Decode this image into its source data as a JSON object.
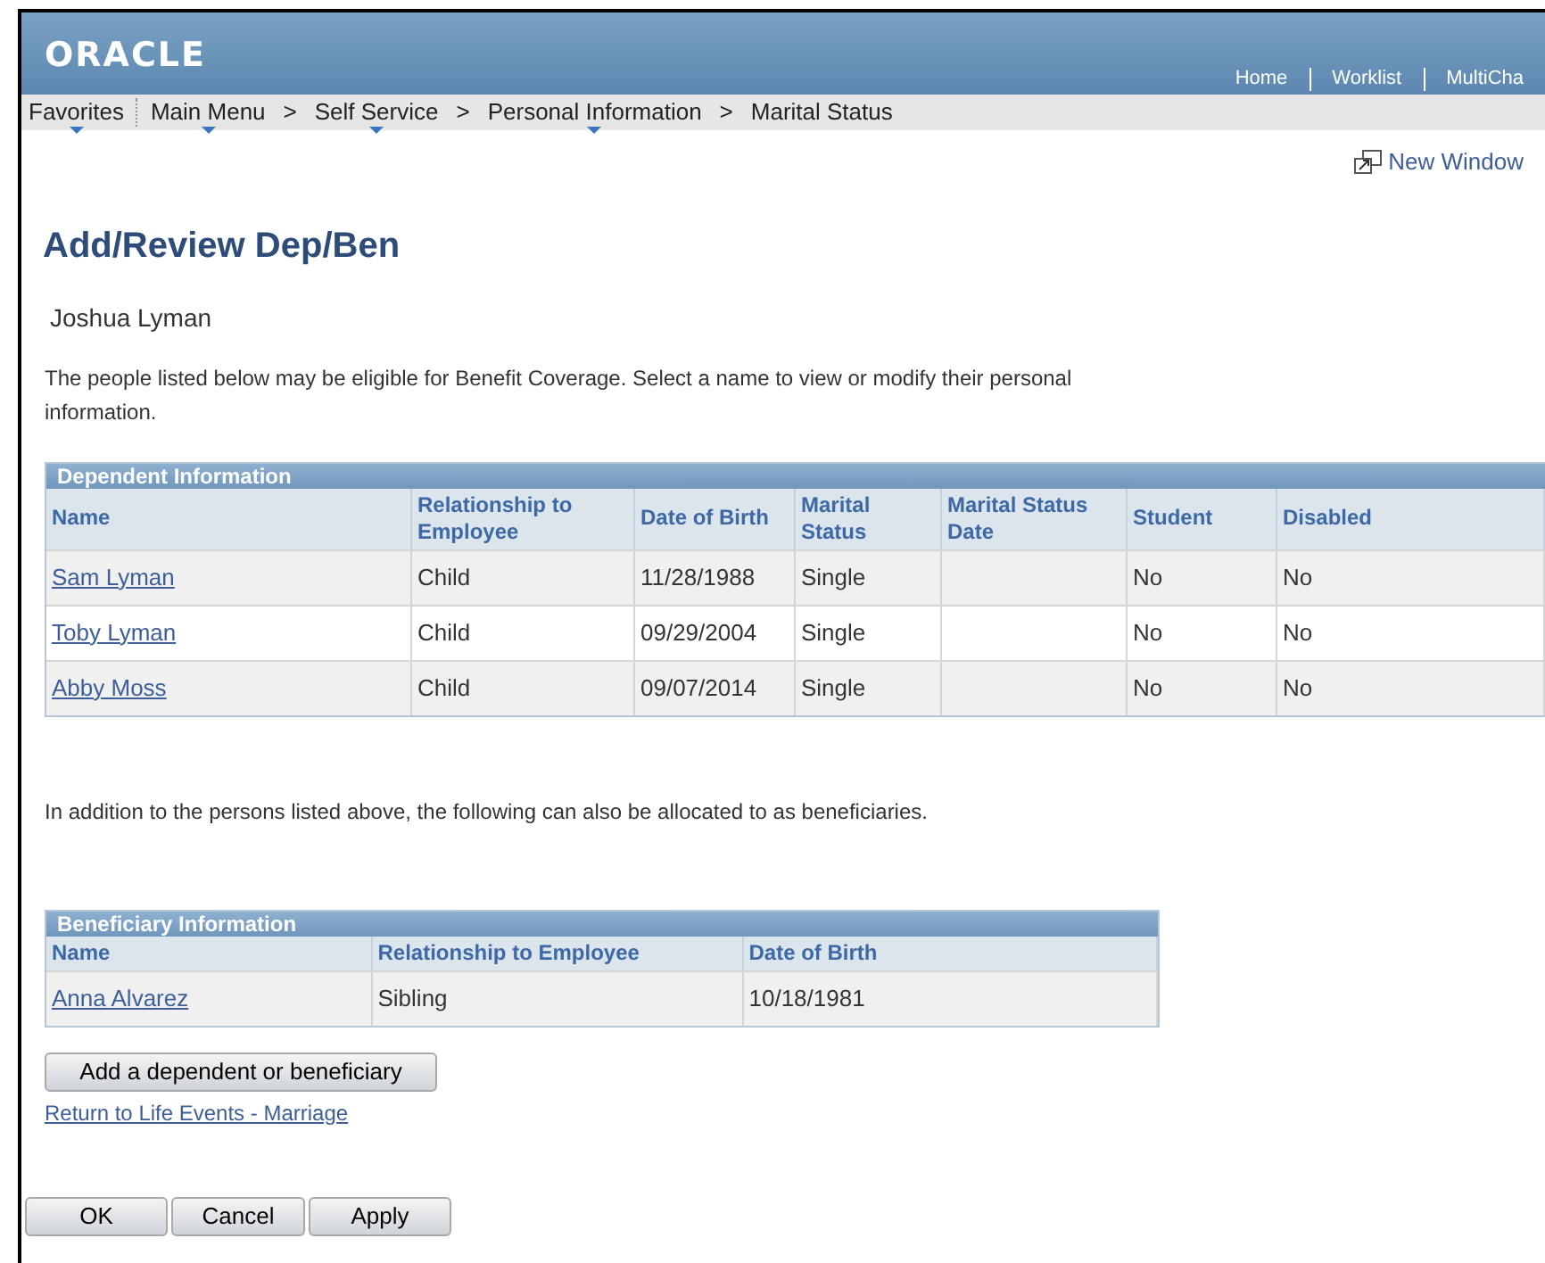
{
  "header": {
    "logo": "ORACLE",
    "links": [
      "Home",
      "Worklist",
      "MultiCha"
    ]
  },
  "breadcrumbs": [
    {
      "label": "Favorites",
      "menu": true
    },
    {
      "label": "Main Menu",
      "menu": true
    },
    {
      "label": "Self Service",
      "menu": true,
      "separator": ">"
    },
    {
      "label": "Personal Information",
      "menu": true,
      "separator": ">"
    },
    {
      "label": "Marital Status",
      "menu": false,
      "separator": ">"
    }
  ],
  "new_window": "New Window",
  "page_title": "Add/Review Dep/Ben",
  "employee_name": "Joshua Lyman",
  "intro": "The people listed below may be eligible for Benefit Coverage. Select a name to view or modify their personal information.",
  "dependents": {
    "title": "Dependent Information",
    "columns": [
      "Name",
      "Relationship to Employee",
      "Date of Birth",
      "Marital Status",
      "Marital Status Date",
      "Student",
      "Disabled"
    ],
    "rows": [
      [
        "Sam Lyman",
        "Child",
        "11/28/1988",
        "Single",
        "",
        "No",
        "No"
      ],
      [
        "Toby Lyman",
        "Child",
        "09/29/2004",
        "Single",
        "",
        "No",
        "No"
      ],
      [
        "Abby Moss",
        "Child",
        "09/07/2014",
        "Single",
        "",
        "No",
        "No"
      ]
    ]
  },
  "note": "In addition to the persons listed above, the following can also be allocated to as beneficiaries.",
  "beneficiaries": {
    "title": "Beneficiary Information",
    "columns": [
      "Name",
      "Relationship to Employee",
      "Date of Birth"
    ],
    "rows": [
      [
        "Anna Alvarez",
        "Sibling",
        "10/18/1981"
      ]
    ]
  },
  "add_button": "Add a dependent or beneficiary",
  "return_link": "Return to Life Events - Marriage",
  "buttons": [
    "OK",
    "Cancel",
    "Apply"
  ]
}
